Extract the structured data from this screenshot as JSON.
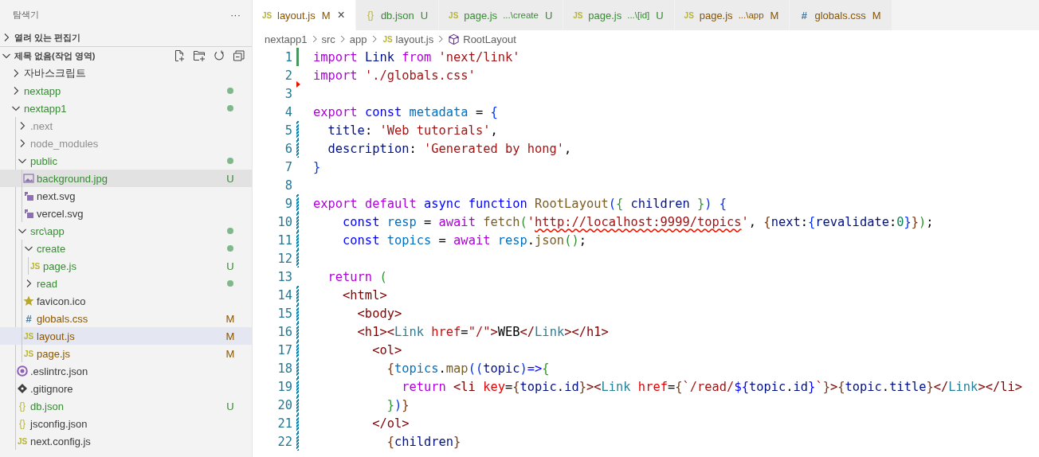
{
  "sidebar": {
    "title": "탐색기",
    "more_label": "···",
    "sections": [
      {
        "label": "열려 있는 편집기",
        "expanded": false
      },
      {
        "label": "제목 없음(작업 영역)",
        "expanded": true
      }
    ],
    "tree": [
      {
        "name": "자바스크립트",
        "kind": "folder",
        "expanded": false,
        "color": "#3b3b3b",
        "changes": false,
        "selected": false,
        "hovered": false
      },
      {
        "name": "nextapp",
        "kind": "folder",
        "expanded": false,
        "color": "#388a34",
        "changes": true,
        "selected": false,
        "hovered": false
      },
      {
        "name": "nextapp1",
        "kind": "folder",
        "expanded": true,
        "color": "#388a34",
        "changes": true,
        "selected": false,
        "hovered": false,
        "children": [
          {
            "name": ".next",
            "kind": "folder",
            "expanded": false,
            "color": "#8e8e90",
            "changes": false,
            "selected": false,
            "hovered": false
          },
          {
            "name": "node_modules",
            "kind": "folder",
            "expanded": false,
            "color": "#8e8e90",
            "changes": false,
            "selected": false,
            "hovered": false
          },
          {
            "name": "public",
            "kind": "folder",
            "expanded": true,
            "color": "#388a34",
            "changes": true,
            "selected": false,
            "hovered": false,
            "children": [
              {
                "name": "background.jpg",
                "kind": "image",
                "color": "#388a34",
                "badge": "U",
                "selected": false,
                "hovered": true
              },
              {
                "name": "next.svg",
                "kind": "svg",
                "color": "#3b3b3b",
                "selected": false,
                "hovered": false
              },
              {
                "name": "vercel.svg",
                "kind": "svg",
                "color": "#3b3b3b",
                "selected": false,
                "hovered": false
              }
            ]
          },
          {
            "name": "src\\app",
            "kind": "folder",
            "expanded": true,
            "color": "#388a34",
            "changes": true,
            "selected": false,
            "hovered": false,
            "children": [
              {
                "name": "create",
                "kind": "folder",
                "expanded": true,
                "color": "#388a34",
                "changes": true,
                "selected": false,
                "hovered": false,
                "children": [
                  {
                    "name": "page.js",
                    "kind": "js",
                    "glyph": "JS",
                    "color": "#388a34",
                    "badge": "U",
                    "selected": false,
                    "hovered": false
                  }
                ]
              },
              {
                "name": "read",
                "kind": "folder",
                "expanded": false,
                "color": "#388a34",
                "changes": true,
                "selected": false,
                "hovered": false
              },
              {
                "name": "favicon.ico",
                "kind": "favicon",
                "color": "#3b3b3b",
                "selected": false,
                "hovered": false
              },
              {
                "name": "globals.css",
                "kind": "css",
                "glyph": "#",
                "color": "#895503",
                "badge": "M",
                "selected": false,
                "hovered": false
              },
              {
                "name": "layout.js",
                "kind": "js",
                "glyph": "JS",
                "color": "#895503",
                "badge": "M",
                "selected": true,
                "hovered": false
              },
              {
                "name": "page.js",
                "kind": "js",
                "glyph": "JS",
                "color": "#895503",
                "badge": "M",
                "selected": false,
                "hovered": false
              }
            ]
          },
          {
            "name": ".eslintrc.json",
            "kind": "eslint",
            "color": "#3b3b3b",
            "selected": false,
            "hovered": false
          },
          {
            "name": ".gitignore",
            "kind": "git",
            "color": "#3b3b3b",
            "selected": false,
            "hovered": false
          },
          {
            "name": "db.json",
            "kind": "json",
            "glyph": "{}",
            "color": "#388a34",
            "badge": "U",
            "selected": false,
            "hovered": false
          },
          {
            "name": "jsconfig.json",
            "kind": "json",
            "glyph": "{}",
            "color": "#3b3b3b",
            "selected": false,
            "hovered": false
          },
          {
            "name": "next.config.js",
            "kind": "js",
            "glyph": "JS",
            "color": "#3b3b3b",
            "selected": false,
            "hovered": false
          }
        ]
      }
    ]
  },
  "tabs": [
    {
      "label": "layout.js",
      "glyph": "JS",
      "kind": "js",
      "badge": "M",
      "color": "#895503",
      "selected": true,
      "close": "×"
    },
    {
      "label": "db.json",
      "glyph": "{}",
      "kind": "json",
      "badge": "U",
      "color": "#388a34",
      "selected": false
    },
    {
      "label": "page.js",
      "description": "...\\create",
      "glyph": "JS",
      "kind": "js",
      "badge": "U",
      "color": "#388a34",
      "selected": false
    },
    {
      "label": "page.js",
      "description": "...\\[id]",
      "glyph": "JS",
      "kind": "js",
      "badge": "U",
      "color": "#388a34",
      "selected": false
    },
    {
      "label": "page.js",
      "description": "...\\app",
      "glyph": "JS",
      "kind": "js",
      "badge": "M",
      "color": "#895503",
      "selected": false
    },
    {
      "label": "globals.css",
      "glyph": "#",
      "kind": "css",
      "badge": "M",
      "color": "#895503",
      "selected": false
    }
  ],
  "breadcrumb": [
    {
      "label": "nextapp1",
      "kind": "folder"
    },
    {
      "label": "src",
      "kind": "folder"
    },
    {
      "label": "app",
      "kind": "folder"
    },
    {
      "label": "layout.js",
      "kind": "file",
      "glyph": "JS"
    },
    {
      "label": "RootLayout",
      "kind": "symbol"
    }
  ],
  "code": [
    {
      "number": "1",
      "kind": "added",
      "tokens": [
        {
          "kind": "kw",
          "text": "import"
        },
        {
          "kind": "var",
          "text": " Link"
        },
        {
          "kind": "kw",
          "text": " from"
        },
        {
          "kind": "str",
          "text": " 'next/link'"
        }
      ]
    },
    {
      "number": "2",
      "kind": "deleted",
      "tokens": [
        {
          "kind": "kw",
          "text": "import"
        },
        {
          "kind": "str",
          "text": " './globals.css'"
        }
      ]
    },
    {
      "number": "3",
      "kind": "plain"
    },
    {
      "number": "4",
      "kind": "plain",
      "tokens": [
        {
          "kind": "kw",
          "text": "export"
        },
        {
          "kind": "decl",
          "text": " const"
        },
        {
          "kind": "cst",
          "text": " metadata"
        },
        {
          "kind": "plain",
          "text": " = "
        },
        {
          "kind": "b1",
          "text": "{"
        }
      ]
    },
    {
      "number": "5",
      "kind": "modified",
      "tokens": [
        {
          "kind": "var",
          "text": "  title"
        },
        {
          "kind": "plain",
          "text": ": "
        },
        {
          "kind": "str",
          "text": "'Web tutorials'"
        },
        {
          "kind": "plain",
          "text": ","
        }
      ]
    },
    {
      "number": "6",
      "kind": "modified",
      "tokens": [
        {
          "kind": "var",
          "text": "  description"
        },
        {
          "kind": "plain",
          "text": ": "
        },
        {
          "kind": "str",
          "text": "'Generated by hong'"
        },
        {
          "kind": "plain",
          "text": ","
        }
      ]
    },
    {
      "number": "7",
      "kind": "plain",
      "tokens": [
        {
          "kind": "b1",
          "text": "}"
        }
      ]
    },
    {
      "number": "8",
      "kind": "plain"
    },
    {
      "number": "9",
      "kind": "modified",
      "tokens": [
        {
          "kind": "kw",
          "text": "export"
        },
        {
          "kind": "kw",
          "text": " default"
        },
        {
          "kind": "decl",
          "text": " async"
        },
        {
          "kind": "decl",
          "text": " function"
        },
        {
          "kind": "fn",
          "text": " RootLayout"
        },
        {
          "kind": "b1",
          "text": "("
        },
        {
          "kind": "b2",
          "text": "{"
        },
        {
          "kind": "var",
          "text": " children "
        },
        {
          "kind": "b2",
          "text": "}"
        },
        {
          "kind": "b1",
          "text": ")"
        },
        {
          "kind": "b1",
          "text": " {"
        }
      ]
    },
    {
      "number": "10",
      "kind": "modified",
      "tokens": [
        {
          "kind": "decl",
          "text": "    const"
        },
        {
          "kind": "cst",
          "text": " resp"
        },
        {
          "kind": "plain",
          "text": " = "
        },
        {
          "kind": "kw",
          "text": "await"
        },
        {
          "kind": "fn",
          "text": " fetch"
        },
        {
          "kind": "b2",
          "text": "("
        },
        {
          "kind": "str",
          "text": "'"
        },
        {
          "kind": "error",
          "text": "http://localhost:9999/topics"
        },
        {
          "kind": "str",
          "text": "'"
        },
        {
          "kind": "plain",
          "text": ", "
        },
        {
          "kind": "b3",
          "text": "{"
        },
        {
          "kind": "var",
          "text": "next"
        },
        {
          "kind": "plain",
          "text": ":"
        },
        {
          "kind": "b1",
          "text": "{"
        },
        {
          "kind": "var",
          "text": "revalidate"
        },
        {
          "kind": "plain",
          "text": ":"
        },
        {
          "kind": "num",
          "text": "0"
        },
        {
          "kind": "b1",
          "text": "}"
        },
        {
          "kind": "b3",
          "text": "}"
        },
        {
          "kind": "b2",
          "text": ")"
        },
        {
          "kind": "plain",
          "text": ";"
        }
      ]
    },
    {
      "number": "11",
      "kind": "modified",
      "tokens": [
        {
          "kind": "decl",
          "text": "    const"
        },
        {
          "kind": "cst",
          "text": " topics"
        },
        {
          "kind": "plain",
          "text": " = "
        },
        {
          "kind": "kw",
          "text": "await"
        },
        {
          "kind": "cst",
          "text": " resp"
        },
        {
          "kind": "plain",
          "text": "."
        },
        {
          "kind": "fn",
          "text": "json"
        },
        {
          "kind": "b2",
          "text": "()"
        },
        {
          "kind": "plain",
          "text": ";"
        }
      ]
    },
    {
      "number": "12",
      "kind": "modified"
    },
    {
      "number": "13",
      "kind": "plain",
      "tokens": [
        {
          "kind": "kw",
          "text": "  return"
        },
        {
          "kind": "b2",
          "text": " ("
        }
      ]
    },
    {
      "number": "14",
      "kind": "modified",
      "tokens": [
        {
          "kind": "tag",
          "text": "    <html>"
        }
      ]
    },
    {
      "number": "15",
      "kind": "modified",
      "tokens": [
        {
          "kind": "tag",
          "text": "      <body>"
        }
      ]
    },
    {
      "number": "16",
      "kind": "modified",
      "tokens": [
        {
          "kind": "tag",
          "text": "      <h1><"
        },
        {
          "kind": "comp",
          "text": "Link"
        },
        {
          "kind": "attr",
          "text": " href"
        },
        {
          "kind": "plain",
          "text": "="
        },
        {
          "kind": "str",
          "text": "\"/\""
        },
        {
          "kind": "tag",
          "text": ">"
        },
        {
          "kind": "plain",
          "text": "WEB"
        },
        {
          "kind": "tag",
          "text": "</"
        },
        {
          "kind": "comp",
          "text": "Link"
        },
        {
          "kind": "tag",
          "text": "></h1>"
        }
      ]
    },
    {
      "number": "17",
      "kind": "modified",
      "tokens": [
        {
          "kind": "tag",
          "text": "        <ol>"
        }
      ]
    },
    {
      "number": "18",
      "kind": "modified",
      "tokens": [
        {
          "kind": "b3",
          "text": "          {"
        },
        {
          "kind": "cst",
          "text": "topics"
        },
        {
          "kind": "plain",
          "text": "."
        },
        {
          "kind": "fn",
          "text": "map"
        },
        {
          "kind": "b1",
          "text": "(("
        },
        {
          "kind": "var",
          "text": "topic"
        },
        {
          "kind": "b1",
          "text": ")"
        },
        {
          "kind": "decl",
          "text": "=>"
        },
        {
          "kind": "b2",
          "text": "{"
        }
      ]
    },
    {
      "number": "19",
      "kind": "modified",
      "tokens": [
        {
          "kind": "kw",
          "text": "            return"
        },
        {
          "kind": "tag",
          "text": " <li"
        },
        {
          "kind": "attr",
          "text": " key"
        },
        {
          "kind": "plain",
          "text": "="
        },
        {
          "kind": "b3",
          "text": "{"
        },
        {
          "kind": "var",
          "text": "topic"
        },
        {
          "kind": "plain",
          "text": "."
        },
        {
          "kind": "var",
          "text": "id"
        },
        {
          "kind": "b3",
          "text": "}"
        },
        {
          "kind": "tag",
          "text": "><"
        },
        {
          "kind": "comp",
          "text": "Link"
        },
        {
          "kind": "attr",
          "text": " href"
        },
        {
          "kind": "plain",
          "text": "="
        },
        {
          "kind": "b3",
          "text": "{"
        },
        {
          "kind": "str",
          "text": "`/read/"
        },
        {
          "kind": "decl",
          "text": "${"
        },
        {
          "kind": "var",
          "text": "topic"
        },
        {
          "kind": "plain",
          "text": "."
        },
        {
          "kind": "var",
          "text": "id"
        },
        {
          "kind": "decl",
          "text": "}"
        },
        {
          "kind": "str",
          "text": "`"
        },
        {
          "kind": "b3",
          "text": "}"
        },
        {
          "kind": "tag",
          "text": ">"
        },
        {
          "kind": "b3",
          "text": "{"
        },
        {
          "kind": "var",
          "text": "topic"
        },
        {
          "kind": "plain",
          "text": "."
        },
        {
          "kind": "var",
          "text": "title"
        },
        {
          "kind": "b3",
          "text": "}"
        },
        {
          "kind": "tag",
          "text": "</"
        },
        {
          "kind": "comp",
          "text": "Link"
        },
        {
          "kind": "tag",
          "text": "></li>"
        }
      ]
    },
    {
      "number": "20",
      "kind": "modified",
      "tokens": [
        {
          "kind": "b2",
          "text": "          }"
        },
        {
          "kind": "b1",
          "text": ")"
        },
        {
          "kind": "b3",
          "text": "}"
        }
      ]
    },
    {
      "number": "21",
      "kind": "modified",
      "tokens": [
        {
          "kind": "tag",
          "text": "        </ol>"
        }
      ]
    },
    {
      "number": "22",
      "kind": "modified",
      "tokens": [
        {
          "kind": "b3",
          "text": "          {"
        },
        {
          "kind": "var",
          "text": "children"
        },
        {
          "kind": "b3",
          "text": "}"
        }
      ]
    }
  ]
}
